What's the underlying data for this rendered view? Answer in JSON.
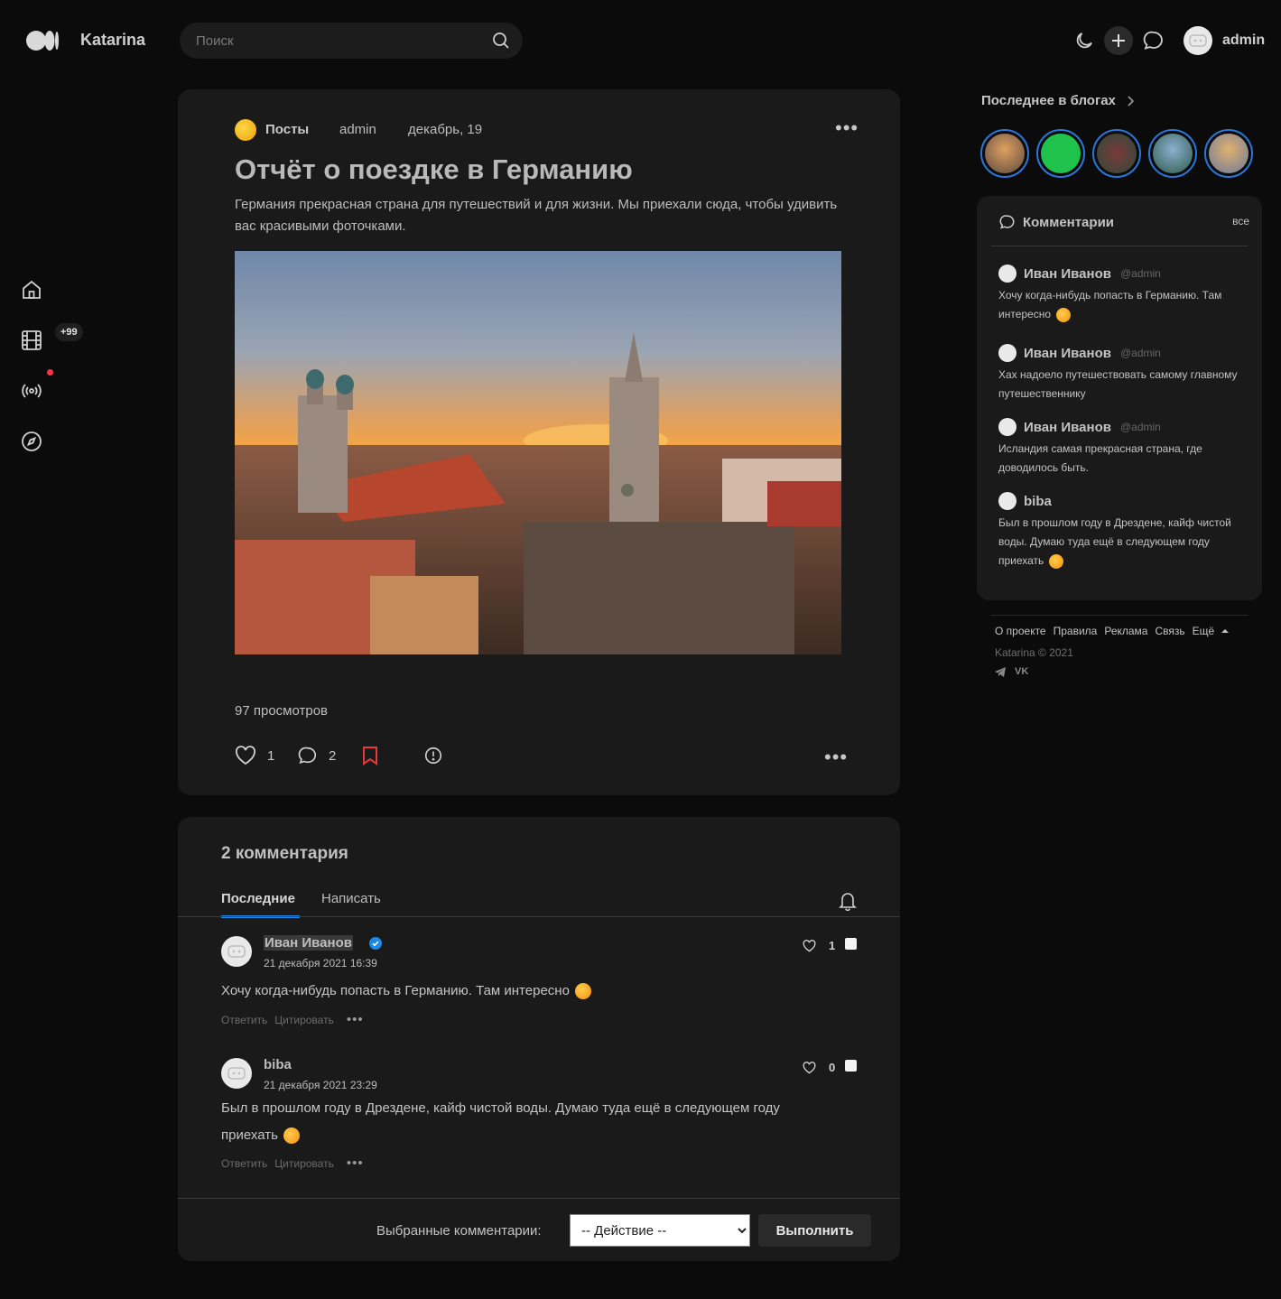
{
  "header": {
    "brand": "Katarina",
    "search_placeholder": "Поиск",
    "user": "admin"
  },
  "nav": {
    "badge": "+99"
  },
  "post": {
    "category": "Посты",
    "author": "admin",
    "date": "декабрь, 19",
    "title": "Отчёт о поездке в Германию",
    "description": "Германия прекрасная страна для путешествий и для жизни. Мы приехали сюда, чтобы удивить вас красивыми фоточками.",
    "views": "97 просмотров",
    "likes": "1",
    "comments": "2"
  },
  "comments_section": {
    "title": "2 комментария",
    "tab_latest": "Последние",
    "tab_write": "Написать",
    "reply": "Ответить",
    "quote": "Цитировать",
    "items": [
      {
        "name": "Иван Иванов",
        "date": "21 декабря 2021 16:39",
        "text": "Хочу когда-нибудь попасть в Германию. Там интересно",
        "likes": "1"
      },
      {
        "name": "biba",
        "date": "21 декабря 2021 23:29",
        "text": "Был в прошлом году в Дрездене, кайф чистой воды. Думаю туда ещё в следующем году приехать",
        "likes": "0"
      }
    ],
    "bulk_label": "Выбранные комментарии:",
    "bulk_select": "-- Действие --",
    "bulk_button": "Выполнить"
  },
  "sidebar_right": {
    "blogs_title": "Последнее в блогах",
    "comments_title": "Комментарии",
    "all": "все",
    "items": [
      {
        "name": "Иван Иванов",
        "handle": "@admin",
        "text": "Хочу когда-нибудь попасть в Германию. Там интересно"
      },
      {
        "name": "Иван Иванов",
        "handle": "@admin",
        "text": "Хах надоело путешествовать самому главному путешественнику"
      },
      {
        "name": "Иван Иванов",
        "handle": "@admin",
        "text": "Исландия самая прекрасная страна, где доводилось быть."
      },
      {
        "name": "biba",
        "handle": "",
        "text": "Был в прошлом году в Дрездене, кайф чистой воды. Думаю туда ещё в следующем году приехать"
      }
    ],
    "footer_links": [
      "О проекте",
      "Правила",
      "Реклама",
      "Связь",
      "Ещё"
    ],
    "copyright": "Katarina © 2021",
    "social": [
      "telegram-icon",
      "vk-icon"
    ]
  },
  "colors": {
    "accent": "#1e88e5",
    "bookmark": "#e53935",
    "notification_dot": "#ff3344"
  }
}
